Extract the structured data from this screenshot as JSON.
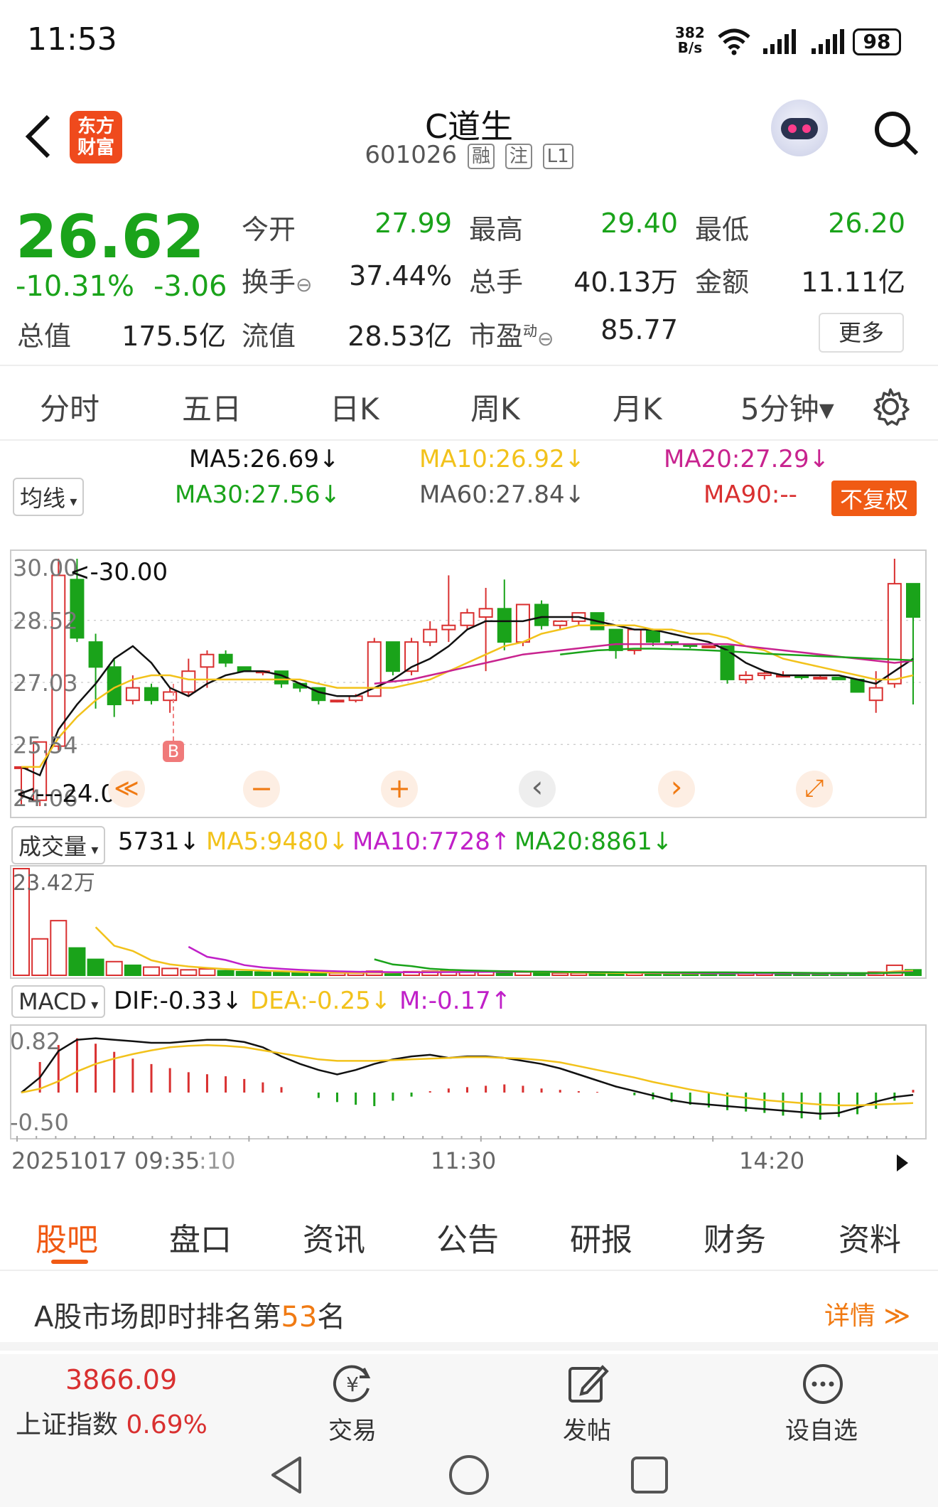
{
  "status_bar": {
    "time": "11:53",
    "net_speed_value": "382",
    "net_speed_unit": "B/s",
    "battery": "98"
  },
  "header": {
    "logo_line1": "东方",
    "logo_line2": "财富",
    "title": "C道生",
    "code": "601026",
    "tags": [
      "融",
      "注",
      "L1"
    ]
  },
  "quote": {
    "price": "26.62",
    "change_pct": "-10.31%",
    "change": "-3.06",
    "open_label": "今开",
    "open": "27.99",
    "high_label": "最高",
    "high": "29.40",
    "low_label": "最低",
    "low": "26.20",
    "turnover_label": "换手",
    "turnover": "37.44%",
    "volume_label": "总手",
    "volume": "40.13万",
    "amount_label": "金额",
    "amount": "11.11亿",
    "mktcap_label": "总值",
    "mktcap": "175.5亿",
    "float_label": "流值",
    "float_cap": "28.53亿",
    "pe_label": "市盈",
    "pe_sup": "动",
    "pe": "85.77",
    "more_label": "更多"
  },
  "period_tabs": [
    "分时",
    "五日",
    "日K",
    "周K",
    "月K",
    "5分钟▾"
  ],
  "active_tab": "5分钟▾",
  "ma_legend": {
    "selector": "均线",
    "ma5": "MA5:26.69↓",
    "ma10": "MA10:26.92↓",
    "ma20": "MA20:27.29↓",
    "ma30": "MA30:27.56↓",
    "ma60": "MA60:27.84↓",
    "ma90": "MA90:--",
    "adjust": "不复权"
  },
  "colors": {
    "up": "#d93030",
    "down": "#1aa31a",
    "ma5": "#111111",
    "ma10": "#f2c21b",
    "ma20": "#c8238f",
    "ma30": "#1aa31a",
    "accent": "#f07a13"
  },
  "chart_data": [
    {
      "type": "candlestick",
      "title": "5分钟K线",
      "y_ticks": [
        "30.00",
        "28.52",
        "27.03",
        "25.54",
        "24.06"
      ],
      "high_marker": "<-30.00",
      "low_marker": "<---24.06",
      "ylim": [
        24.06,
        30.0
      ],
      "ohlc": [
        [
          25.0,
          25.0,
          24.06,
          25.0
        ],
        [
          24.2,
          25.6,
          24.06,
          25.6
        ],
        [
          25.5,
          30.0,
          25.4,
          29.6
        ],
        [
          29.5,
          30.0,
          28.0,
          28.1
        ],
        [
          28.0,
          28.2,
          26.4,
          27.4
        ],
        [
          27.4,
          27.6,
          26.2,
          26.5
        ],
        [
          26.6,
          27.2,
          26.5,
          26.9
        ],
        [
          26.9,
          27.0,
          26.5,
          26.6
        ],
        [
          26.6,
          26.9,
          26.3,
          26.8
        ],
        [
          26.8,
          27.6,
          26.7,
          27.3
        ],
        [
          27.4,
          27.8,
          26.9,
          27.7
        ],
        [
          27.7,
          27.8,
          27.4,
          27.5
        ],
        [
          27.4,
          27.4,
          27.3,
          27.3
        ],
        [
          27.3,
          27.3,
          27.2,
          27.3
        ],
        [
          27.3,
          27.3,
          26.9,
          27.0
        ],
        [
          27.0,
          27.0,
          26.8,
          26.9
        ],
        [
          26.9,
          26.9,
          26.5,
          26.6
        ],
        [
          26.6,
          26.6,
          26.55,
          26.6
        ],
        [
          26.6,
          26.75,
          26.55,
          26.7
        ],
        [
          26.7,
          28.1,
          26.7,
          28.0
        ],
        [
          28.0,
          28.0,
          27.2,
          27.3
        ],
        [
          27.3,
          28.1,
          27.2,
          28.0
        ],
        [
          28.0,
          28.5,
          27.9,
          28.3
        ],
        [
          28.3,
          29.6,
          28.0,
          28.4
        ],
        [
          28.4,
          28.8,
          28.3,
          28.7
        ],
        [
          28.6,
          29.3,
          27.3,
          28.8
        ],
        [
          28.8,
          29.5,
          27.8,
          28.0
        ],
        [
          28.0,
          28.9,
          27.9,
          28.9
        ],
        [
          28.9,
          29.0,
          28.3,
          28.4
        ],
        [
          28.4,
          28.5,
          28.3,
          28.5
        ],
        [
          28.5,
          28.7,
          28.4,
          28.7
        ],
        [
          28.7,
          28.7,
          28.3,
          28.3
        ],
        [
          28.3,
          28.3,
          27.6,
          27.8
        ],
        [
          27.8,
          28.3,
          27.7,
          28.3
        ],
        [
          28.3,
          28.3,
          27.9,
          28.0
        ],
        [
          28.0,
          28.0,
          27.9,
          27.95
        ],
        [
          27.95,
          27.95,
          27.85,
          27.9
        ],
        [
          27.9,
          27.9,
          27.85,
          27.9
        ],
        [
          27.9,
          27.9,
          27.0,
          27.1
        ],
        [
          27.1,
          27.3,
          27.0,
          27.2
        ],
        [
          27.2,
          27.3,
          27.1,
          27.25
        ],
        [
          27.2,
          27.3,
          27.15,
          27.2
        ],
        [
          27.2,
          27.2,
          27.1,
          27.15
        ],
        [
          27.15,
          27.2,
          27.1,
          27.15
        ],
        [
          27.15,
          27.15,
          27.1,
          27.1
        ],
        [
          27.1,
          27.1,
          26.8,
          26.8
        ],
        [
          26.6,
          27.3,
          26.3,
          26.9
        ],
        [
          27.0,
          30.0,
          26.9,
          29.4
        ],
        [
          29.4,
          29.4,
          26.5,
          28.6
        ]
      ],
      "ma_series": [
        {
          "name": "MA5",
          "values": [
            25.0,
            24.8,
            25.9,
            26.5,
            27.0,
            27.6,
            27.9,
            27.5,
            26.9,
            26.7,
            27.0,
            27.2,
            27.3,
            27.3,
            27.2,
            27.0,
            26.8,
            26.7,
            26.7,
            26.9,
            27.1,
            27.4,
            27.6,
            27.9,
            28.3,
            28.5,
            28.5,
            28.5,
            28.6,
            28.6,
            28.6,
            28.5,
            28.4,
            28.3,
            28.3,
            28.2,
            28.1,
            28.0,
            27.8,
            27.5,
            27.3,
            27.2,
            27.2,
            27.2,
            27.2,
            27.1,
            27.0,
            27.3,
            27.6
          ]
        },
        {
          "name": "MA10",
          "values": [
            25.0,
            25.0,
            25.7,
            26.2,
            26.6,
            26.9,
            27.1,
            27.2,
            27.2,
            27.1,
            27.1,
            27.1,
            27.1,
            27.1,
            27.1,
            27.1,
            27.0,
            26.9,
            26.9,
            26.9,
            26.9,
            27.0,
            27.1,
            27.3,
            27.5,
            27.7,
            27.9,
            28.0,
            28.2,
            28.3,
            28.4,
            28.4,
            28.4,
            28.4,
            28.3,
            28.3,
            28.2,
            28.2,
            28.1,
            27.9,
            27.8,
            27.6,
            27.5,
            27.4,
            27.3,
            27.2,
            27.1,
            27.1,
            27.2
          ]
        },
        {
          "name": "MA20",
          "values": [
            null,
            null,
            null,
            null,
            null,
            null,
            null,
            null,
            null,
            null,
            null,
            null,
            null,
            null,
            null,
            null,
            null,
            null,
            null,
            27.0,
            27.05,
            27.1,
            27.2,
            27.3,
            27.4,
            27.5,
            27.6,
            27.7,
            27.75,
            27.8,
            27.85,
            27.9,
            27.95,
            27.95,
            27.95,
            27.95,
            27.95,
            27.95,
            27.95,
            27.9,
            27.85,
            27.8,
            27.75,
            27.7,
            27.65,
            27.6,
            27.55,
            27.5,
            27.55
          ]
        },
        {
          "name": "MA30",
          "values": [
            null,
            null,
            null,
            null,
            null,
            null,
            null,
            null,
            null,
            null,
            null,
            null,
            null,
            null,
            null,
            null,
            null,
            null,
            null,
            null,
            null,
            null,
            null,
            null,
            null,
            null,
            null,
            null,
            null,
            27.7,
            27.75,
            27.8,
            27.82,
            27.84,
            27.84,
            27.83,
            27.82,
            27.8,
            27.78,
            27.75,
            27.72,
            27.7,
            27.68,
            27.66,
            27.64,
            27.62,
            27.6,
            27.58,
            27.56
          ]
        }
      ],
      "marker_b_label": "B"
    },
    {
      "type": "bar",
      "title": "成交量",
      "selector": "成交量",
      "current": "5731↓",
      "ma5": "MA5:9480↓",
      "ma10": "MA10:7728↑",
      "ma20": "MA20:8861↓",
      "y_max_label": "23.42万",
      "ylim": [
        0,
        234200
      ],
      "values": [
        234200,
        80000,
        120000,
        60000,
        35000,
        30000,
        22000,
        18000,
        15000,
        12000,
        14000,
        10000,
        8000,
        7000,
        6000,
        6000,
        5000,
        5000,
        5000,
        9000,
        7000,
        8000,
        9000,
        10000,
        8000,
        9000,
        8000,
        7000,
        6000,
        5000,
        5000,
        5000,
        5000,
        5000,
        4000,
        4000,
        4000,
        4000,
        5000,
        4000,
        4000,
        4000,
        4000,
        4000,
        4000,
        5000,
        7000,
        22000,
        12000
      ],
      "up": [
        1,
        1,
        1,
        0,
        0,
        1,
        0,
        1,
        1,
        1,
        1,
        0,
        0,
        0,
        0,
        0,
        0,
        1,
        1,
        1,
        0,
        1,
        1,
        1,
        1,
        1,
        0,
        1,
        0,
        1,
        1,
        0,
        0,
        1,
        0,
        0,
        0,
        0,
        0,
        1,
        1,
        0,
        0,
        0,
        0,
        0,
        1,
        1,
        0
      ]
    },
    {
      "type": "bar",
      "title": "MACD",
      "selector": "MACD",
      "dif": "DIF:-0.33↓",
      "dea": "DEA:-0.25↓",
      "m": "M:-0.17↑",
      "y_ticks": [
        "0.82",
        "-0.50"
      ],
      "ylim": [
        -0.5,
        0.82
      ],
      "hist": [
        0.0,
        0.45,
        0.7,
        0.8,
        0.72,
        0.6,
        0.5,
        0.42,
        0.36,
        0.3,
        0.27,
        0.24,
        0.2,
        0.15,
        0.08,
        0.0,
        -0.08,
        -0.14,
        -0.18,
        -0.2,
        -0.12,
        -0.06,
        0.02,
        0.06,
        0.08,
        0.1,
        0.12,
        0.1,
        0.06,
        0.04,
        0.02,
        0.01,
        0.0,
        -0.04,
        -0.1,
        -0.14,
        -0.18,
        -0.22,
        -0.26,
        -0.28,
        -0.3,
        -0.34,
        -0.38,
        -0.4,
        -0.36,
        -0.32,
        -0.24,
        -0.12,
        0.04
      ],
      "dif_line": [
        0.0,
        0.2,
        0.55,
        0.7,
        0.72,
        0.7,
        0.68,
        0.66,
        0.66,
        0.68,
        0.7,
        0.7,
        0.67,
        0.6,
        0.48,
        0.38,
        0.3,
        0.24,
        0.3,
        0.38,
        0.44,
        0.48,
        0.5,
        0.46,
        0.48,
        0.48,
        0.46,
        0.42,
        0.38,
        0.32,
        0.24,
        0.16,
        0.08,
        0.02,
        -0.04,
        -0.1,
        -0.14,
        -0.16,
        -0.18,
        -0.2,
        -0.22,
        -0.24,
        -0.26,
        -0.28,
        -0.27,
        -0.2,
        -0.12,
        -0.06,
        -0.03
      ],
      "dea_line": [
        0.0,
        0.05,
        0.15,
        0.28,
        0.38,
        0.45,
        0.51,
        0.56,
        0.6,
        0.62,
        0.63,
        0.62,
        0.6,
        0.56,
        0.52,
        0.48,
        0.44,
        0.42,
        0.42,
        0.42,
        0.43,
        0.44,
        0.45,
        0.46,
        0.47,
        0.47,
        0.46,
        0.45,
        0.43,
        0.4,
        0.35,
        0.3,
        0.25,
        0.2,
        0.14,
        0.09,
        0.04,
        0.0,
        -0.04,
        -0.07,
        -0.1,
        -0.12,
        -0.14,
        -0.16,
        -0.17,
        -0.17,
        -0.16,
        -0.15,
        -0.14
      ]
    }
  ],
  "x_axis": {
    "start": "20251017 09:35",
    "start_tail": ":10",
    "mid": "11:30",
    "late": "14:20"
  },
  "chart_controls": [
    "≪",
    "−",
    "+",
    "‹",
    "›",
    "⤢"
  ],
  "info_tabs": [
    "股吧",
    "盘口",
    "资讯",
    "公告",
    "研报",
    "财务",
    "资料"
  ],
  "active_info_tab": "股吧",
  "rank": {
    "prefix": "A股市场即时排名第",
    "number": "53",
    "suffix": "名",
    "detail": "详情 ≫"
  },
  "bottom": {
    "index_value": "3866.09",
    "index_name": "上证指数",
    "index_change": "0.69%",
    "trade": "交易",
    "post": "发帖",
    "watchlist": "设自选"
  }
}
